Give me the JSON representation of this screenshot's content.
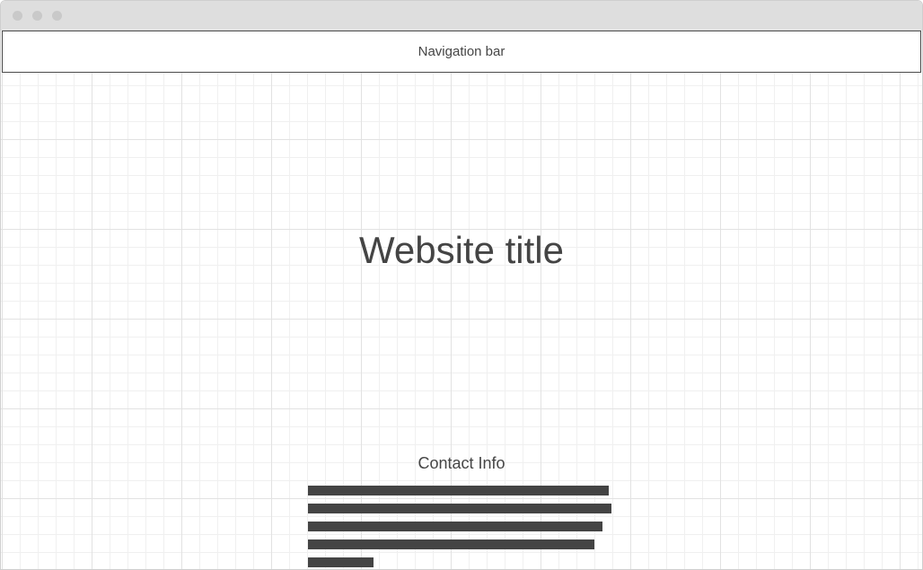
{
  "window": {
    "title": ""
  },
  "navbar": {
    "label": "Navigation bar"
  },
  "hero": {
    "title": "Website title"
  },
  "contact": {
    "heading": "Contact Info",
    "placeholder_lines": 5
  },
  "colors": {
    "titlebar": "#dedede",
    "window_dots": "#c9c9c9",
    "text": "#444444",
    "grid_major": "#e2e2e2",
    "grid_minor": "#f0f0f0"
  }
}
